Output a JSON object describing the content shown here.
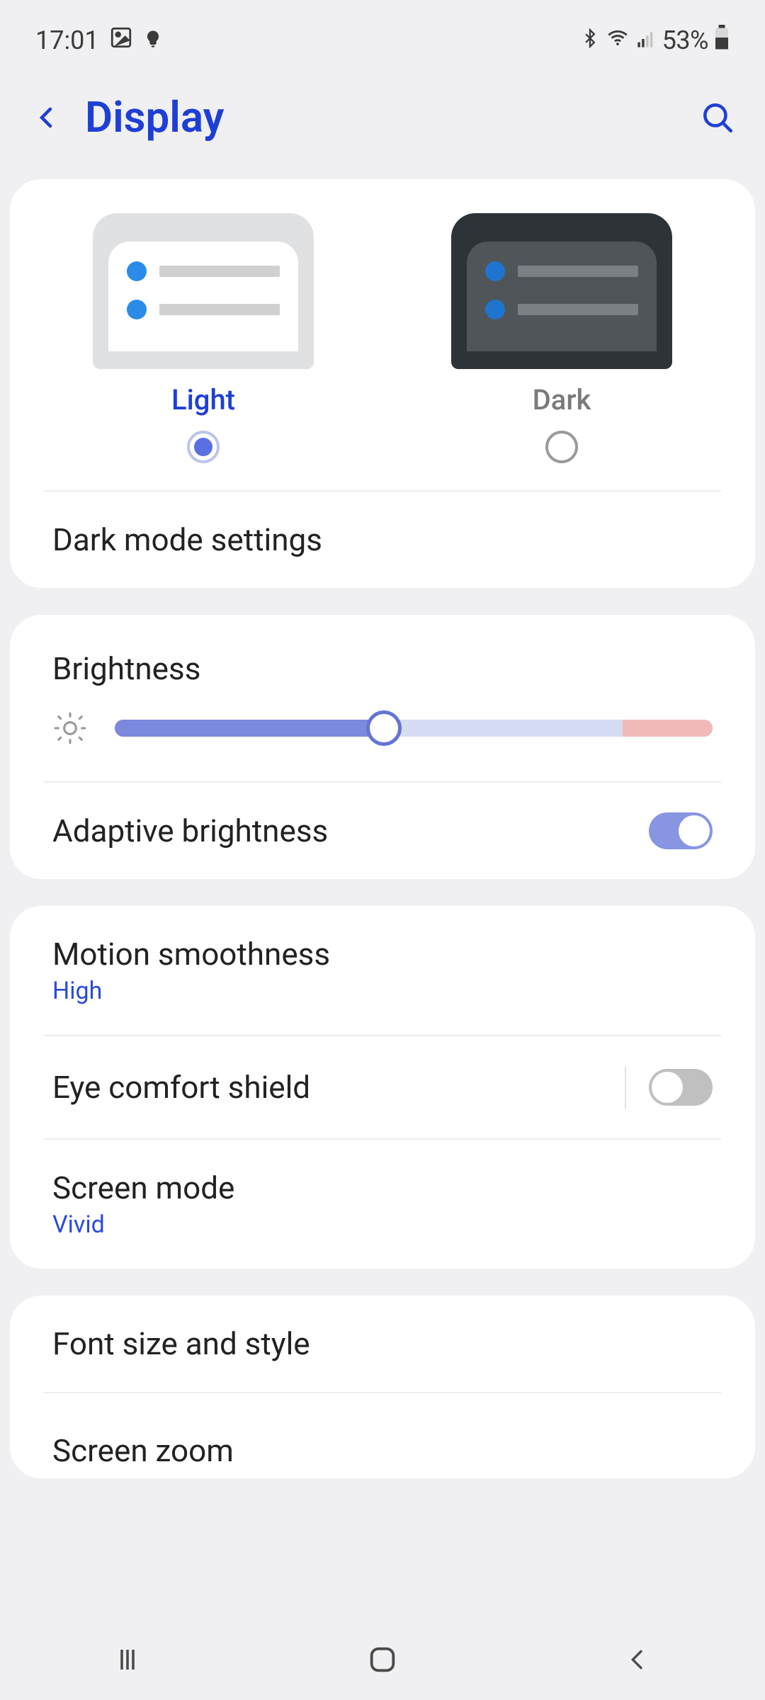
{
  "statusbar": {
    "time": "17:01",
    "battery_text": "53%"
  },
  "header": {
    "title": "Display"
  },
  "theme": {
    "light_label": "Light",
    "dark_label": "Dark",
    "selected": "light"
  },
  "dark_mode_settings_label": "Dark mode settings",
  "brightness": {
    "label": "Brightness",
    "value_percent": 45
  },
  "adaptive_brightness": {
    "label": "Adaptive brightness",
    "enabled": true
  },
  "motion_smoothness": {
    "label": "Motion smoothness",
    "value": "High"
  },
  "eye_comfort": {
    "label": "Eye comfort shield",
    "enabled": false
  },
  "screen_mode": {
    "label": "Screen mode",
    "value": "Vivid"
  },
  "font_size_style_label": "Font size and style",
  "screen_zoom_label": "Screen zoom",
  "colors": {
    "accent": "#1e3fd6",
    "slider_fill": "#7b88dd",
    "slider_warn": "#f2b9b9",
    "toggle_on": "#8895e3"
  }
}
